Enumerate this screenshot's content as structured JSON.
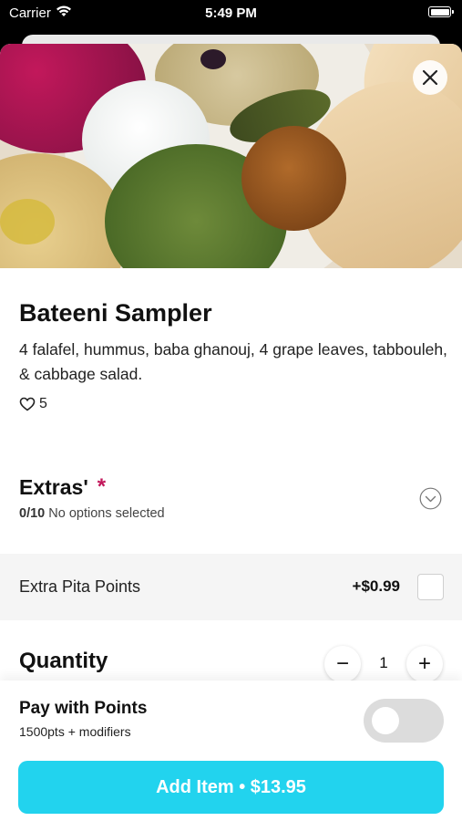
{
  "status_bar": {
    "carrier": "Carrier",
    "time": "5:49 PM",
    "icons": [
      "wifi-icon",
      "battery-icon"
    ]
  },
  "item": {
    "name": "Bateeni Sampler",
    "description": "4 falafel, hummus, baba ghanouj, 4 grape leaves, tabbouleh, & cabbage salad.",
    "likes": "5",
    "image_icon": "food-photo"
  },
  "extras": {
    "title": "Extras'",
    "required_marker": "*",
    "count": "0/10",
    "status": "No options selected",
    "options": [
      {
        "label": "Extra Pita Points",
        "price": "+$0.99",
        "checked": false
      }
    ]
  },
  "quantity": {
    "title": "Quantity",
    "minus": "−",
    "value": "1",
    "plus": "+"
  },
  "points": {
    "title": "Pay with Points",
    "subtitle": "1500pts + modifiers",
    "enabled": false
  },
  "cta": {
    "label": "Add Item • $13.95"
  },
  "colors": {
    "accent": "#22d3ee",
    "required": "#c2185b",
    "row_bg": "#f5f5f5"
  }
}
